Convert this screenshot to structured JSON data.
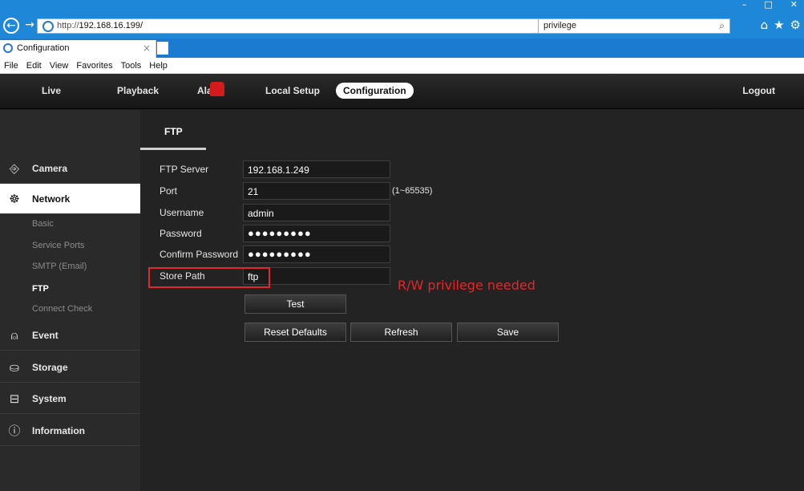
{
  "browser": {
    "url": "http://192.168.16.199/",
    "url_prefix": "http://",
    "url_host": "192.168.16.199/",
    "search": "privilege",
    "tab_title": "Configuration",
    "tab_close": "×",
    "menu": [
      "File",
      "Edit",
      "View",
      "Favorites",
      "Tools",
      "Help"
    ],
    "controls": {
      "minimize": "–",
      "maximize": "□",
      "close": "✕"
    },
    "icons": {
      "back": "←",
      "forward": "→",
      "refresh": "⟳",
      "dropdown": "▾",
      "search": "⌕",
      "home": "⌂",
      "favorites": "★",
      "settings": "⚙"
    }
  },
  "app_nav": {
    "items": [
      "Live",
      "Playback",
      "Alarm",
      "Local Setup",
      "Configuration"
    ],
    "active": "Configuration",
    "logout": "Logout"
  },
  "sidebar": {
    "sections": [
      {
        "label": "Camera",
        "icon": "camera-icon"
      },
      {
        "label": "Network",
        "icon": "network-icon",
        "active": true
      },
      {
        "label": "Event",
        "icon": "event-icon"
      },
      {
        "label": "Storage",
        "icon": "storage-icon"
      },
      {
        "label": "System",
        "icon": "system-icon"
      },
      {
        "label": "Information",
        "icon": "information-icon"
      }
    ],
    "network_sub": [
      "Basic",
      "Service Ports",
      "SMTP (Email)",
      "FTP",
      "Connect Check"
    ],
    "active_sub": "FTP",
    "icon_glyphs": {
      "camera": "⎆",
      "network": "☸",
      "event": "⍝",
      "storage": "⛀",
      "system": "⊟",
      "information": "ⓘ"
    }
  },
  "page": {
    "tab": "FTP",
    "fields": {
      "ftp_server": {
        "label": "FTP Server",
        "value": "192.168.1.249"
      },
      "port": {
        "label": "Port",
        "value": "21",
        "hint": "(1~65535)"
      },
      "username": {
        "label": "Username",
        "value": "admin"
      },
      "password": {
        "label": "Password",
        "value": "●●●●●●●●●"
      },
      "confirm_password": {
        "label": "Confirm Password",
        "value": "●●●●●●●●●"
      },
      "store_path": {
        "label": "Store Path",
        "value": "ftp"
      }
    },
    "annotation": "R/W privilege needed",
    "buttons": {
      "test": "Test",
      "reset": "Reset Defaults",
      "refresh": "Refresh",
      "save": "Save"
    }
  },
  "colors": {
    "accent_blue": "#1f87d8",
    "annotation_red": "#e5262a",
    "alarm_red": "#d31b1b",
    "background": "#232323"
  }
}
